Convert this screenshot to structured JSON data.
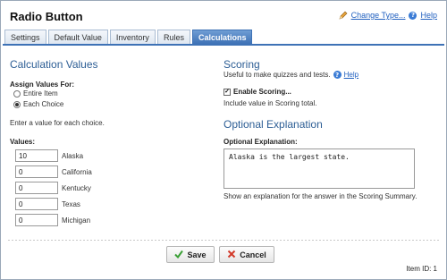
{
  "window": {
    "title": "Radio Button",
    "change_type_label": "Change Type...",
    "help_label": "Help"
  },
  "tabs": [
    {
      "label": "Settings",
      "active": false
    },
    {
      "label": "Default Value",
      "active": false
    },
    {
      "label": "Inventory",
      "active": false
    },
    {
      "label": "Rules",
      "active": false
    },
    {
      "label": "Calculations",
      "active": true
    }
  ],
  "calc": {
    "heading": "Calculation Values",
    "assign_label": "Assign Values For:",
    "options": [
      {
        "label": "Entire Item",
        "checked": false
      },
      {
        "label": "Each Choice",
        "checked": true
      }
    ],
    "instruction": "Enter a value for each choice.",
    "values_label": "Values:",
    "rows": [
      {
        "value": "10",
        "choice": "Alaska"
      },
      {
        "value": "0",
        "choice": "California"
      },
      {
        "value": "0",
        "choice": "Kentucky"
      },
      {
        "value": "0",
        "choice": "Texas"
      },
      {
        "value": "0",
        "choice": "Michigan"
      }
    ]
  },
  "scoring": {
    "heading": "Scoring",
    "description": "Useful to make quizzes and tests.",
    "help_label": "Help",
    "enable_label": "Enable Scoring...",
    "enabled": true,
    "note": "Include value in Scoring total."
  },
  "explanation": {
    "heading": "Optional Explanation",
    "label": "Optional Explanation:",
    "value": "Alaska is the largest state.",
    "note": "Show an explanation for the answer in the Scoring Summary."
  },
  "footer": {
    "save_label": "Save",
    "cancel_label": "Cancel",
    "item_id": "Item ID: 1"
  },
  "colors": {
    "accent": "#3e72b6",
    "heading": "#2d5e95",
    "link": "#1f5fbf",
    "save_icon": "#3aa035",
    "cancel_icon": "#d23a2a"
  }
}
